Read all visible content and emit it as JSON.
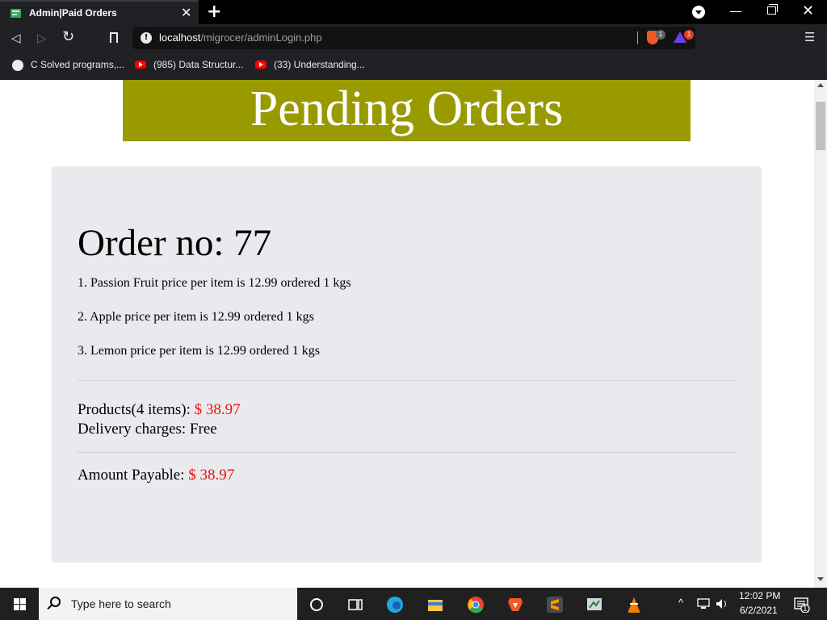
{
  "browser": {
    "tab_title": "Admin|Paid Orders",
    "url_host": "localhost",
    "url_path": "/migrocer/adminLogin.php",
    "shield_badge": "1",
    "rewards_badge": "1",
    "bookmarks": [
      "C Solved programs,...",
      "(985) Data Structur...",
      "(33) Understanding..."
    ]
  },
  "page": {
    "banner_title": "Pending Orders",
    "order": {
      "heading": "Order no: 77",
      "items": [
        "1. Passion Fruit price per item is 12.99 ordered 1 kgs",
        "2. Apple price per item is 12.99 ordered 1 kgs",
        "3. Lemon price per item is 12.99 ordered 1 kgs"
      ],
      "products_label": "Products(4 items): ",
      "products_value": "$ 38.97",
      "delivery_label": "Delivery charges: Free",
      "payable_label": "Amount Payable: ",
      "payable_value": "$ 38.97"
    }
  },
  "taskbar": {
    "search_placeholder": "Type here to search",
    "time": "12:02 PM",
    "date": "6/2/2021",
    "notification_count": "1"
  },
  "colors": {
    "banner": "#999900",
    "card": "#e8eaed",
    "price": "#ee1111"
  }
}
